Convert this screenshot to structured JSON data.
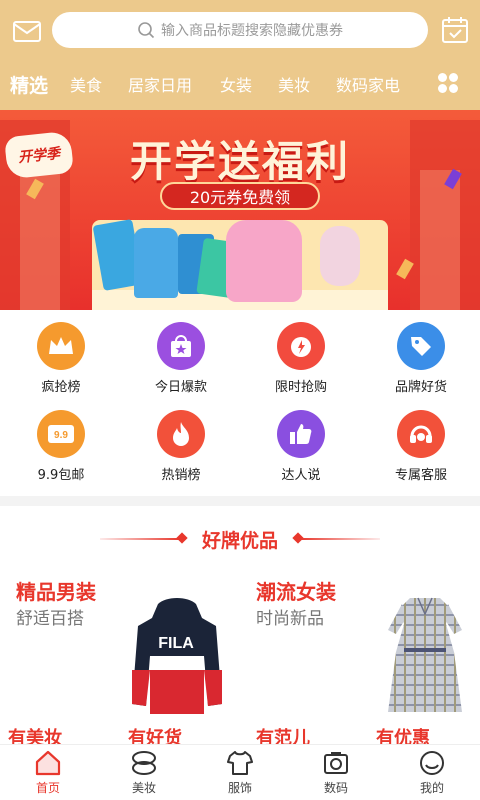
{
  "search": {
    "placeholder": "输入商品标题搜索隐藏优惠券"
  },
  "tabs": [
    "精选",
    "美食",
    "居家日用",
    "女装",
    "美妆",
    "数码家电"
  ],
  "banner": {
    "logo_text": "开学季",
    "title": "开学送福利",
    "coupon": "20元券免费领"
  },
  "grid": [
    {
      "label": "疯抢榜",
      "icon": "crown-icon",
      "color": "#f59a2e"
    },
    {
      "label": "今日爆款",
      "icon": "star-bag-icon",
      "color": "#9b4fe0"
    },
    {
      "label": "限时抢购",
      "icon": "alarm-clock-icon",
      "color": "#f24b3e"
    },
    {
      "label": "品牌好货",
      "icon": "tag-icon",
      "color": "#3b8ee8"
    },
    {
      "label": "9.9包邮",
      "icon": "price-9-9-icon",
      "color": "#f59a2e"
    },
    {
      "label": "热销榜",
      "icon": "flame-icon",
      "color": "#f2513a"
    },
    {
      "label": "达人说",
      "icon": "thumbs-up-icon",
      "color": "#8a4fe0"
    },
    {
      "label": "专属客服",
      "icon": "headset-icon",
      "color": "#f2513a"
    }
  ],
  "brand": {
    "title": "好牌优品",
    "cards": [
      {
        "title": "精品男装",
        "sub": "舒适百搭"
      },
      {
        "title": "潮流女装",
        "sub": "时尚新品"
      }
    ],
    "hoodie_brand": "FILA",
    "cut_labels": [
      "有美妆",
      "有好货",
      "有范儿",
      "有优惠"
    ]
  },
  "bottom_nav": [
    {
      "label": "首页",
      "icon": "home-icon",
      "active": true
    },
    {
      "label": "美妆",
      "icon": "makeup-icon",
      "active": false
    },
    {
      "label": "服饰",
      "icon": "shirt-icon",
      "active": false
    },
    {
      "label": "数码",
      "icon": "camera-icon",
      "active": false
    },
    {
      "label": "我的",
      "icon": "profile-icon",
      "active": false
    }
  ],
  "colors": {
    "header": "#ecc98c",
    "accent": "#e8372c"
  }
}
